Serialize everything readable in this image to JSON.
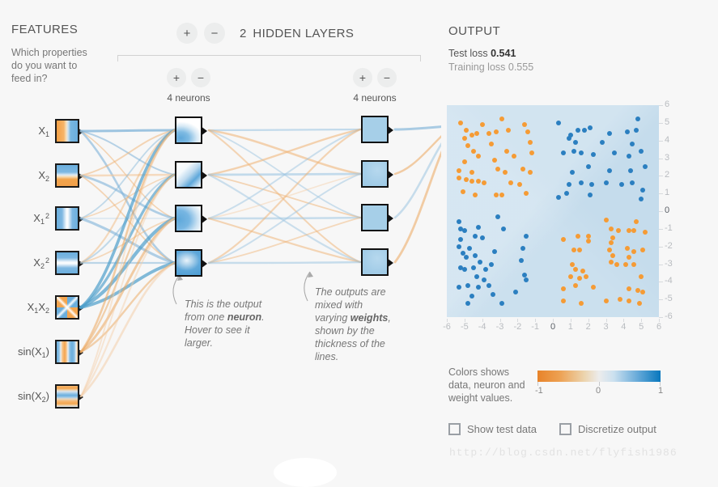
{
  "features": {
    "title": "FEATURES",
    "description": "Which properties do you want to feed in?",
    "items": [
      {
        "label_html": "X<sub>1</sub>",
        "name": "x1",
        "thumb": "t-x1"
      },
      {
        "label_html": "X<sub>2</sub>",
        "name": "x2",
        "thumb": "t-x2"
      },
      {
        "label_html": "X<sub>1</sub><sup>2</sup>",
        "name": "x1-squared",
        "thumb": "t-x1s"
      },
      {
        "label_html": "X<sub>2</sub><sup>2</sup>",
        "name": "x2-squared",
        "thumb": "t-x2s"
      },
      {
        "label_html": "X<sub>1</sub>X<sub>2</sub>",
        "name": "x1x2",
        "thumb": "t-x1x2"
      },
      {
        "label_html": "sin(X<sub>1</sub>)",
        "name": "sin-x1",
        "thumb": "t-sinx1"
      },
      {
        "label_html": "sin(X<sub>2</sub>)",
        "name": "sin-x2",
        "thumb": "t-sinx2"
      }
    ]
  },
  "network": {
    "add_layer_label": "+",
    "remove_layer_label": "−",
    "hidden_layer_count": "2",
    "hidden_layers_label": "HIDDEN LAYERS",
    "layers": [
      {
        "add_label": "+",
        "remove_label": "−",
        "neuron_count_label": "4 neurons"
      },
      {
        "add_label": "+",
        "remove_label": "−",
        "neuron_count_label": "4 neurons"
      }
    ],
    "annotation_neuron": {
      "part1": "This is the output from one ",
      "bold": "neuron",
      "part2": ". Hover to see it larger."
    },
    "annotation_weights": {
      "part1": "The outputs are mixed with varying ",
      "bold": "weights",
      "part2": ", shown by the thickness of the lines."
    }
  },
  "output": {
    "title": "OUTPUT",
    "test_loss_label": "Test loss ",
    "test_loss_value": "0.541",
    "training_loss_label": "Training loss ",
    "training_loss_value": "0.555",
    "x_ticks": [
      "-6",
      "-5",
      "-4",
      "-3",
      "-2",
      "-1",
      "0",
      "1",
      "2",
      "3",
      "4",
      "5",
      "6"
    ],
    "y_ticks": [
      "6",
      "5",
      "4",
      "3",
      "2",
      "1",
      "0",
      "-1",
      "-2",
      "-3",
      "-4",
      "-5",
      "-6"
    ],
    "legend_text": "Colors shows data, neuron and weight values.",
    "colorbar": {
      "min_label": "-1",
      "mid_label": "0",
      "max_label": "1",
      "color_negative": "#e8832a",
      "color_neutral": "#ececec",
      "color_positive": "#0877bd"
    },
    "checkboxes": [
      {
        "label": "Show test data",
        "checked": false
      },
      {
        "label": "Discretize output",
        "checked": false
      }
    ]
  },
  "watermark": "http://blog.csdn.net/flyfish1986",
  "chart_data": {
    "type": "scatter",
    "title": "OUTPUT",
    "xlabel": "",
    "ylabel": "",
    "xlim": [
      -6,
      6
    ],
    "ylim": [
      -6,
      6
    ],
    "grid": false,
    "legend": "colorbar",
    "classes": [
      {
        "name": "positive",
        "color": "#f59b35"
      },
      {
        "name": "negative",
        "color": "#2b7fc0"
      }
    ],
    "description": "XOR-style classification: orange points in upper-left and lower-right quadrants, blue points in upper-right and lower-left quadrants.",
    "points": [
      {
        "x": -5.2,
        "y": 5.0,
        "c": "o"
      },
      {
        "x": -4.9,
        "y": 4.6,
        "c": "o"
      },
      {
        "x": -4.0,
        "y": 4.9,
        "c": "o"
      },
      {
        "x": -2.9,
        "y": 5.2,
        "c": "o"
      },
      {
        "x": -1.6,
        "y": 4.9,
        "c": "o"
      },
      {
        "x": -5.0,
        "y": 4.1,
        "c": "o"
      },
      {
        "x": -4.6,
        "y": 4.3,
        "c": "o"
      },
      {
        "x": -4.3,
        "y": 4.4,
        "c": "o"
      },
      {
        "x": -3.6,
        "y": 4.4,
        "c": "o"
      },
      {
        "x": -3.2,
        "y": 4.5,
        "c": "o"
      },
      {
        "x": -2.5,
        "y": 4.6,
        "c": "o"
      },
      {
        "x": -1.4,
        "y": 4.5,
        "c": "o"
      },
      {
        "x": -4.8,
        "y": 3.7,
        "c": "o"
      },
      {
        "x": -4.5,
        "y": 3.4,
        "c": "o"
      },
      {
        "x": -3.5,
        "y": 3.8,
        "c": "o"
      },
      {
        "x": -1.3,
        "y": 3.9,
        "c": "o"
      },
      {
        "x": -4.2,
        "y": 3.1,
        "c": "o"
      },
      {
        "x": -2.6,
        "y": 3.4,
        "c": "o"
      },
      {
        "x": -2.2,
        "y": 3.1,
        "c": "o"
      },
      {
        "x": -1.2,
        "y": 3.3,
        "c": "o"
      },
      {
        "x": -5.0,
        "y": 2.8,
        "c": "o"
      },
      {
        "x": -3.3,
        "y": 2.9,
        "c": "o"
      },
      {
        "x": -5.3,
        "y": 2.3,
        "c": "o"
      },
      {
        "x": -4.6,
        "y": 2.2,
        "c": "o"
      },
      {
        "x": -3.1,
        "y": 2.4,
        "c": "o"
      },
      {
        "x": -2.7,
        "y": 2.2,
        "c": "o"
      },
      {
        "x": -1.7,
        "y": 2.4,
        "c": "o"
      },
      {
        "x": -1.3,
        "y": 2.2,
        "c": "o"
      },
      {
        "x": -5.3,
        "y": 1.9,
        "c": "o"
      },
      {
        "x": -4.9,
        "y": 1.8,
        "c": "o"
      },
      {
        "x": -4.6,
        "y": 1.7,
        "c": "o"
      },
      {
        "x": -4.2,
        "y": 1.7,
        "c": "o"
      },
      {
        "x": -3.9,
        "y": 1.6,
        "c": "o"
      },
      {
        "x": -2.4,
        "y": 1.6,
        "c": "o"
      },
      {
        "x": -1.9,
        "y": 1.5,
        "c": "o"
      },
      {
        "x": -5.1,
        "y": 1.1,
        "c": "o"
      },
      {
        "x": -4.4,
        "y": 0.9,
        "c": "o"
      },
      {
        "x": -3.2,
        "y": 0.9,
        "c": "o"
      },
      {
        "x": -2.9,
        "y": 0.9,
        "c": "o"
      },
      {
        "x": -1.5,
        "y": 1.0,
        "c": "o"
      },
      {
        "x": 0.3,
        "y": 5.0,
        "c": "b"
      },
      {
        "x": 1.4,
        "y": 4.6,
        "c": "b"
      },
      {
        "x": 2.1,
        "y": 4.7,
        "c": "b"
      },
      {
        "x": 4.8,
        "y": 5.2,
        "c": "b"
      },
      {
        "x": 1.0,
        "y": 4.3,
        "c": "b"
      },
      {
        "x": 1.8,
        "y": 4.6,
        "c": "b"
      },
      {
        "x": 3.2,
        "y": 4.4,
        "c": "b"
      },
      {
        "x": 4.2,
        "y": 4.5,
        "c": "b"
      },
      {
        "x": 4.7,
        "y": 4.6,
        "c": "b"
      },
      {
        "x": 0.9,
        "y": 4.1,
        "c": "b"
      },
      {
        "x": 1.3,
        "y": 3.9,
        "c": "b"
      },
      {
        "x": 2.8,
        "y": 3.9,
        "c": "b"
      },
      {
        "x": 4.5,
        "y": 3.8,
        "c": "b"
      },
      {
        "x": 0.6,
        "y": 3.3,
        "c": "b"
      },
      {
        "x": 1.2,
        "y": 3.4,
        "c": "b"
      },
      {
        "x": 1.6,
        "y": 3.3,
        "c": "b"
      },
      {
        "x": 2.3,
        "y": 3.2,
        "c": "b"
      },
      {
        "x": 3.5,
        "y": 3.3,
        "c": "b"
      },
      {
        "x": 4.3,
        "y": 3.1,
        "c": "b"
      },
      {
        "x": 5.0,
        "y": 3.4,
        "c": "b"
      },
      {
        "x": 2.0,
        "y": 2.5,
        "c": "b"
      },
      {
        "x": 3.2,
        "y": 2.3,
        "c": "b"
      },
      {
        "x": 4.4,
        "y": 2.3,
        "c": "b"
      },
      {
        "x": 5.2,
        "y": 2.5,
        "c": "b"
      },
      {
        "x": 1.1,
        "y": 2.2,
        "c": "b"
      },
      {
        "x": 0.9,
        "y": 1.5,
        "c": "b"
      },
      {
        "x": 1.6,
        "y": 1.6,
        "c": "b"
      },
      {
        "x": 2.2,
        "y": 1.5,
        "c": "b"
      },
      {
        "x": 3.0,
        "y": 1.6,
        "c": "b"
      },
      {
        "x": 3.9,
        "y": 1.5,
        "c": "b"
      },
      {
        "x": 4.5,
        "y": 1.6,
        "c": "b"
      },
      {
        "x": 5.1,
        "y": 1.2,
        "c": "b"
      },
      {
        "x": 0.8,
        "y": 1.0,
        "c": "b"
      },
      {
        "x": 2.1,
        "y": 0.9,
        "c": "b"
      },
      {
        "x": 0.3,
        "y": 0.8,
        "c": "b"
      },
      {
        "x": 5.0,
        "y": 0.7,
        "c": "b"
      },
      {
        "x": -5.3,
        "y": -0.6,
        "c": "b"
      },
      {
        "x": -3.1,
        "y": -0.3,
        "c": "b"
      },
      {
        "x": -5.2,
        "y": -1.0,
        "c": "b"
      },
      {
        "x": -5.0,
        "y": -1.1,
        "c": "b"
      },
      {
        "x": -4.2,
        "y": -0.9,
        "c": "b"
      },
      {
        "x": -2.8,
        "y": -1.0,
        "c": "b"
      },
      {
        "x": -5.2,
        "y": -1.6,
        "c": "b"
      },
      {
        "x": -4.4,
        "y": -1.4,
        "c": "b"
      },
      {
        "x": -4.0,
        "y": -1.5,
        "c": "b"
      },
      {
        "x": -1.5,
        "y": -1.4,
        "c": "b"
      },
      {
        "x": -5.3,
        "y": -2.0,
        "c": "b"
      },
      {
        "x": -4.7,
        "y": -2.1,
        "c": "b"
      },
      {
        "x": -5.1,
        "y": -2.4,
        "c": "b"
      },
      {
        "x": -4.9,
        "y": -2.6,
        "c": "b"
      },
      {
        "x": -4.4,
        "y": -2.5,
        "c": "b"
      },
      {
        "x": -3.3,
        "y": -2.3,
        "c": "b"
      },
      {
        "x": -1.7,
        "y": -2.1,
        "c": "b"
      },
      {
        "x": -4.1,
        "y": -2.9,
        "c": "b"
      },
      {
        "x": -3.5,
        "y": -3.0,
        "c": "b"
      },
      {
        "x": -1.8,
        "y": -2.8,
        "c": "b"
      },
      {
        "x": -5.2,
        "y": -3.2,
        "c": "b"
      },
      {
        "x": -5.0,
        "y": -3.3,
        "c": "b"
      },
      {
        "x": -4.5,
        "y": -3.2,
        "c": "b"
      },
      {
        "x": -3.8,
        "y": -3.3,
        "c": "b"
      },
      {
        "x": -4.3,
        "y": -3.7,
        "c": "b"
      },
      {
        "x": -3.9,
        "y": -3.9,
        "c": "b"
      },
      {
        "x": -1.6,
        "y": -3.6,
        "c": "b"
      },
      {
        "x": -1.5,
        "y": -3.9,
        "c": "b"
      },
      {
        "x": -5.3,
        "y": -4.3,
        "c": "b"
      },
      {
        "x": -4.8,
        "y": -4.2,
        "c": "b"
      },
      {
        "x": -4.2,
        "y": -4.3,
        "c": "b"
      },
      {
        "x": -3.6,
        "y": -4.2,
        "c": "b"
      },
      {
        "x": -4.6,
        "y": -4.8,
        "c": "b"
      },
      {
        "x": -3.4,
        "y": -4.7,
        "c": "b"
      },
      {
        "x": -2.1,
        "y": -4.6,
        "c": "b"
      },
      {
        "x": -4.8,
        "y": -5.2,
        "c": "b"
      },
      {
        "x": -2.9,
        "y": -5.2,
        "c": "b"
      },
      {
        "x": 3.0,
        "y": -0.5,
        "c": "o"
      },
      {
        "x": 4.7,
        "y": -0.6,
        "c": "o"
      },
      {
        "x": 3.3,
        "y": -1.0,
        "c": "o"
      },
      {
        "x": 3.7,
        "y": -1.1,
        "c": "o"
      },
      {
        "x": 4.3,
        "y": -1.1,
        "c": "o"
      },
      {
        "x": 4.6,
        "y": -1.1,
        "c": "o"
      },
      {
        "x": 5.2,
        "y": -1.2,
        "c": "o"
      },
      {
        "x": 1.4,
        "y": -1.4,
        "c": "o"
      },
      {
        "x": 2.0,
        "y": -1.4,
        "c": "o"
      },
      {
        "x": 3.4,
        "y": -1.5,
        "c": "o"
      },
      {
        "x": 0.6,
        "y": -1.6,
        "c": "o"
      },
      {
        "x": 2.0,
        "y": -1.7,
        "c": "o"
      },
      {
        "x": 3.3,
        "y": -1.8,
        "c": "o"
      },
      {
        "x": 1.2,
        "y": -2.2,
        "c": "o"
      },
      {
        "x": 1.5,
        "y": -2.2,
        "c": "o"
      },
      {
        "x": 3.2,
        "y": -2.2,
        "c": "o"
      },
      {
        "x": 4.2,
        "y": -2.1,
        "c": "o"
      },
      {
        "x": 4.6,
        "y": -2.3,
        "c": "o"
      },
      {
        "x": 5.1,
        "y": -2.2,
        "c": "o"
      },
      {
        "x": 3.4,
        "y": -2.5,
        "c": "o"
      },
      {
        "x": 4.3,
        "y": -2.6,
        "c": "o"
      },
      {
        "x": 1.1,
        "y": -3.0,
        "c": "o"
      },
      {
        "x": 3.3,
        "y": -2.9,
        "c": "o"
      },
      {
        "x": 3.6,
        "y": -3.0,
        "c": "o"
      },
      {
        "x": 4.1,
        "y": -3.0,
        "c": "o"
      },
      {
        "x": 4.6,
        "y": -3.0,
        "c": "o"
      },
      {
        "x": 1.3,
        "y": -3.3,
        "c": "o"
      },
      {
        "x": 1.7,
        "y": -3.4,
        "c": "o"
      },
      {
        "x": 1.0,
        "y": -3.7,
        "c": "o"
      },
      {
        "x": 1.5,
        "y": -3.8,
        "c": "o"
      },
      {
        "x": 1.9,
        "y": -3.7,
        "c": "o"
      },
      {
        "x": 5.0,
        "y": -3.7,
        "c": "o"
      },
      {
        "x": 1.3,
        "y": -4.2,
        "c": "o"
      },
      {
        "x": 2.3,
        "y": -4.3,
        "c": "o"
      },
      {
        "x": 0.6,
        "y": -4.4,
        "c": "o"
      },
      {
        "x": 4.3,
        "y": -4.4,
        "c": "o"
      },
      {
        "x": 4.8,
        "y": -4.5,
        "c": "o"
      },
      {
        "x": 5.1,
        "y": -4.6,
        "c": "o"
      },
      {
        "x": 0.6,
        "y": -5.1,
        "c": "o"
      },
      {
        "x": 1.6,
        "y": -5.2,
        "c": "o"
      },
      {
        "x": 3.0,
        "y": -5.1,
        "c": "o"
      },
      {
        "x": 3.8,
        "y": -5.0,
        "c": "o"
      },
      {
        "x": 4.3,
        "y": -5.1,
        "c": "o"
      },
      {
        "x": 4.9,
        "y": -5.2,
        "c": "o"
      }
    ]
  }
}
